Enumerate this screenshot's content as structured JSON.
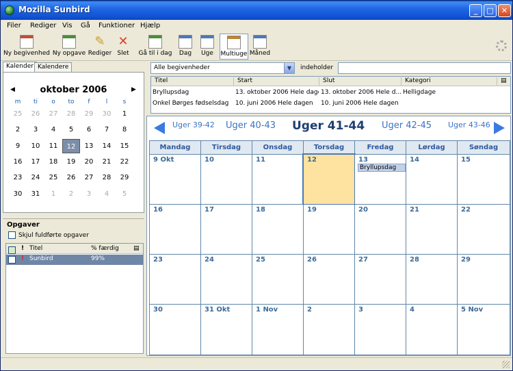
{
  "window": {
    "title": "Mozilla Sunbird"
  },
  "menu": [
    "Filer",
    "Rediger",
    "Vis",
    "Gå",
    "Funktioner",
    "Hjælp"
  ],
  "toolbar": [
    {
      "label": "Ny begivenhed",
      "icon": "new-event-icon"
    },
    {
      "label": "Ny opgave",
      "icon": "new-task-icon"
    },
    {
      "label": "Rediger",
      "icon": "edit-pencil-icon"
    },
    {
      "label": "Slet",
      "icon": "delete-x-icon"
    },
    {
      "label": "Gå til i dag",
      "icon": "go-today-icon"
    },
    {
      "label": "Dag",
      "icon": "day-view-icon"
    },
    {
      "label": "Uge",
      "icon": "week-view-icon"
    },
    {
      "label": "Multiuge",
      "icon": "multiweek-view-icon",
      "active": true
    },
    {
      "label": "Måned",
      "icon": "month-view-icon"
    }
  ],
  "left_tabs": [
    "Kalender",
    "Kalendere"
  ],
  "minical": {
    "title": "oktober  2006",
    "dow": [
      "m",
      "ti",
      "o",
      "to",
      "f",
      "l",
      "s"
    ],
    "weeks": [
      [
        "25",
        "26",
        "27",
        "28",
        "29",
        "30",
        "1"
      ],
      [
        "2",
        "3",
        "4",
        "5",
        "6",
        "7",
        "8"
      ],
      [
        "9",
        "10",
        "11",
        "12",
        "13",
        "14",
        "15"
      ],
      [
        "16",
        "17",
        "18",
        "19",
        "20",
        "21",
        "22"
      ],
      [
        "23",
        "24",
        "25",
        "26",
        "27",
        "28",
        "29"
      ],
      [
        "30",
        "31",
        "1",
        "2",
        "3",
        "4",
        "5"
      ]
    ],
    "today": "12"
  },
  "tasks": {
    "title": "Opgaver",
    "hide_label": "Skjul fuldførte opgaver",
    "columns": [
      "Titel",
      "% færdig"
    ],
    "rows": [
      {
        "title": "Sunbird",
        "percent": "99%",
        "priority": "!"
      }
    ]
  },
  "filter": {
    "selected": "Alle begivenheder",
    "contains_label": "indeholder",
    "search_value": ""
  },
  "events": {
    "columns": [
      "Titel",
      "Start",
      "Slut",
      "Kategori"
    ],
    "rows": [
      {
        "title": "Bryllupsdag",
        "start": "13. oktober 2006 Hele dagen",
        "end": "13. oktober 2006 Hele d...",
        "category": "Helligdage"
      },
      {
        "title": "Onkel Børges fødselsdag",
        "start": "10. juni 2006 Hele dagen",
        "end": "10. juni 2006 Hele dagen",
        "category": ""
      }
    ]
  },
  "nav": {
    "prev2": "Uger 39-42",
    "prev1": "Uger 40-43",
    "current": "Uger 41-44",
    "next1": "Uger 42-45",
    "next2": "Uger 43-46"
  },
  "multiweek": {
    "days": [
      "Mandag",
      "Tirsdag",
      "Onsdag",
      "Torsdag",
      "Fredag",
      "Lørdag",
      "Søndag"
    ],
    "weeks": [
      [
        "9 Okt",
        "10",
        "11",
        "12",
        "13",
        "14",
        "15"
      ],
      [
        "16",
        "17",
        "18",
        "19",
        "20",
        "21",
        "22"
      ],
      [
        "23",
        "24",
        "25",
        "26",
        "27",
        "28",
        "29"
      ],
      [
        "30",
        "31 Okt",
        "1 Nov",
        "2",
        "3",
        "4",
        "5 Nov"
      ]
    ],
    "today_index": [
      0,
      3
    ],
    "event": {
      "week": 0,
      "day": 4,
      "label": "Bryllupsdag"
    }
  },
  "colors": {
    "accent": "#2d5aa0",
    "today_cell": "#fde2a0",
    "grid_line": "#5f86a8"
  }
}
